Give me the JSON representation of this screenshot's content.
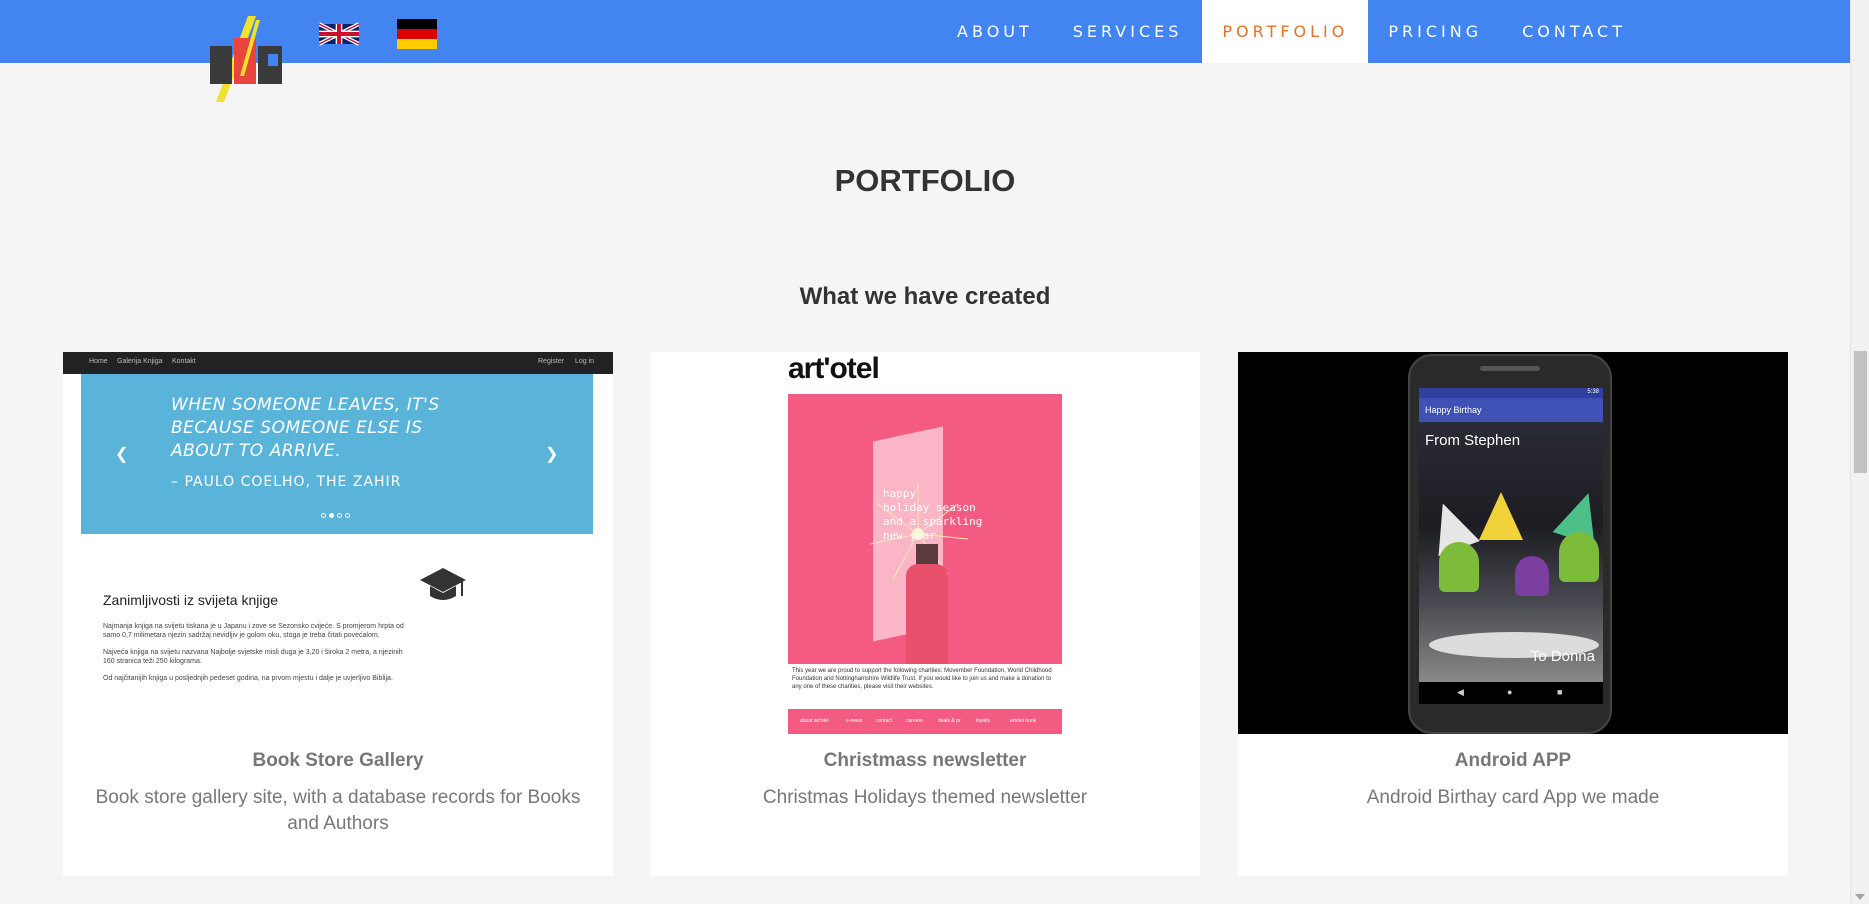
{
  "header": {
    "nav_items": [
      "ABOUT",
      "SERVICES",
      "PORTFOLIO",
      "PRICING",
      "CONTACT"
    ],
    "active_item": "PORTFOLIO",
    "languages": [
      "english-flag",
      "german-flag"
    ]
  },
  "section": {
    "title": "PORTFOLIO",
    "subtitle": "What we have created"
  },
  "cards": [
    {
      "title": "Book Store Gallery",
      "description": "Book store gallery site, with a database records for Books and Authors",
      "thumb": {
        "nav_left": [
          "Home",
          "Galerija Knjiga",
          "Kontakt"
        ],
        "nav_right": [
          "Register",
          "Log in"
        ],
        "quote": "WHEN SOMEONE LEAVES, IT'S BECAUSE SOMEONE ELSE IS ABOUT TO ARRIVE.",
        "author": "– PAULO COELHO, THE ZAHIR",
        "heading": "Zanimljivosti iz svijeta knjige",
        "paragraphs": [
          "Najmanja knjiga na svijetu tiskana je u Japanu i zove se Sezonsko cvijeće. S promjerom hrpta od samo 0,7 milimetara njezin sadržaj nevidljiv je golom oku, stoga je treba čitati povećalom.",
          "Najveća knjiga na svijetu nazvana Najbolje svjetske misli duga je 3,20 i široka 2 metra, a njezinih 160 stranica teži 250 kilograma.",
          "Od najčitanijih knjiga u posljednjih pedeset godina, na prvom mjestu i dalje je uvjerljivo Biblija."
        ]
      }
    },
    {
      "title": "Christmass newsletter",
      "description": "Christmas Holidays themed newsletter",
      "thumb": {
        "logo": "art'otel",
        "greeting": [
          "happy",
          "holiday season",
          "and a sparkling",
          "new year"
        ],
        "footer_text": "This year we are proud to support the following charities: Movember Foundation, World Childhood Foundation and Nottinghamshire Wildlife Trust. If you would like to join us and make a donation to any one of these charities, please visit their websites.",
        "footer_links": [
          "about art'otel",
          "e-news",
          "contact",
          "careers",
          "deals & pr",
          "loyalty",
          "artotel book"
        ]
      }
    },
    {
      "title": "Android APP",
      "description": "Android Birthay card App we made",
      "thumb": {
        "time": "5:38",
        "app_title": "Happy Birthay",
        "from": "From Stephen",
        "to": "To Donna"
      }
    }
  ],
  "colors": {
    "navbar": "#4285f0",
    "active_nav_text": "#e2722c",
    "page_bg": "#f5f5f5"
  }
}
